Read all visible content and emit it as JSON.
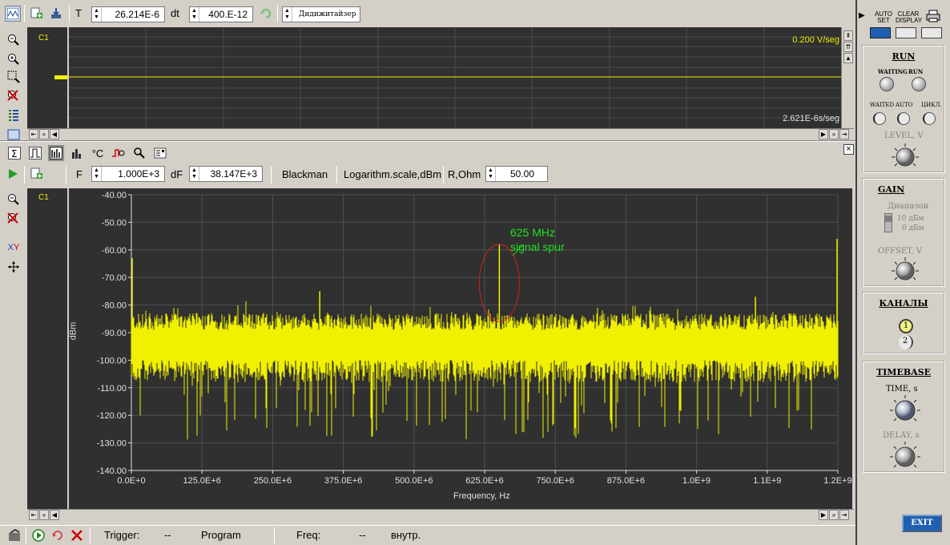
{
  "top_toolbar": {
    "t_label": "T",
    "t_value": "26.214E-6",
    "dt_label": "dt",
    "dt_value": "400.E-12",
    "mode_value": "Дидижитайзер"
  },
  "scope_panel": {
    "channel": "C1",
    "scale_right": "0.200 V/seg",
    "time_per_div": "2.621E-6s/seg"
  },
  "spectrum_toolbar": {
    "f_label": "F",
    "f_value": "1.000E+3",
    "df_label": "dF",
    "df_value": "38.147E+3",
    "window": "Blackman",
    "scale": "Logarithm.scale,dBm",
    "r_label": "R,Ohm",
    "r_value": "50.00"
  },
  "spectrum_panel": {
    "channel": "C1",
    "ylabel": "dBm",
    "xlabel": "Frequency, Hz",
    "annotation_line1": "625 MHz",
    "annotation_line2": "signal spur"
  },
  "chart_data": {
    "type": "line",
    "xlabel": "Frequency, Hz",
    "ylabel": "dBm",
    "ylim": [
      -140,
      -40
    ],
    "xlim": [
      0,
      1200000000
    ],
    "y_ticks": [
      "-40.00",
      "-50.00",
      "-60.00",
      "-70.00",
      "-80.00",
      "-90.00",
      "-100.00",
      "-110.00",
      "-120.00",
      "-130.00",
      "-140.00"
    ],
    "x_ticks": [
      "0.0E+0",
      "125.0E+6",
      "250.0E+6",
      "375.0E+6",
      "500.0E+6",
      "625.0E+6",
      "750.0E+6",
      "875.0E+6",
      "1.0E+9",
      "1.1E+9",
      "1.2E+9"
    ],
    "noise_floor_dbm": -95,
    "peaks": [
      {
        "x": 0,
        "y": -63
      },
      {
        "x": 320000000,
        "y": -75
      },
      {
        "x": 625000000,
        "y": -58
      },
      {
        "x": 1060000000,
        "y": -77
      },
      {
        "x": 1200000000,
        "y": -56
      }
    ],
    "series_color": "#f0f000",
    "annotation": {
      "text": "625 MHz signal spur",
      "x": 625000000,
      "y": -60
    }
  },
  "right_panel": {
    "auto_set": "AUTO SET",
    "clear_display": "CLEAR DISPLAY",
    "run_title": "RUN",
    "waiting": "WAITING",
    "run": "RUN",
    "waited": "WAITED",
    "auto": "AUTO",
    "cycle": "ЦИКЛ.",
    "level": "LEVEL, V",
    "gain_title": "GAIN",
    "range": "Диапазон",
    "range_10": "10 дБм",
    "range_0": "0 дБм",
    "offset": "OFFSET, V",
    "channels_title": "КАНАЛЫ",
    "ch1": "1",
    "ch2": "2",
    "timebase_title": "TIMEBASE",
    "time": "TIME, s",
    "delay": "DELAY, s",
    "exit": "EXIT"
  },
  "status": {
    "trigger_label": "Trigger:",
    "trigger_value": "--",
    "program": "Program",
    "freq_label": "Freq:",
    "freq_value": "--",
    "source": "внутр."
  }
}
